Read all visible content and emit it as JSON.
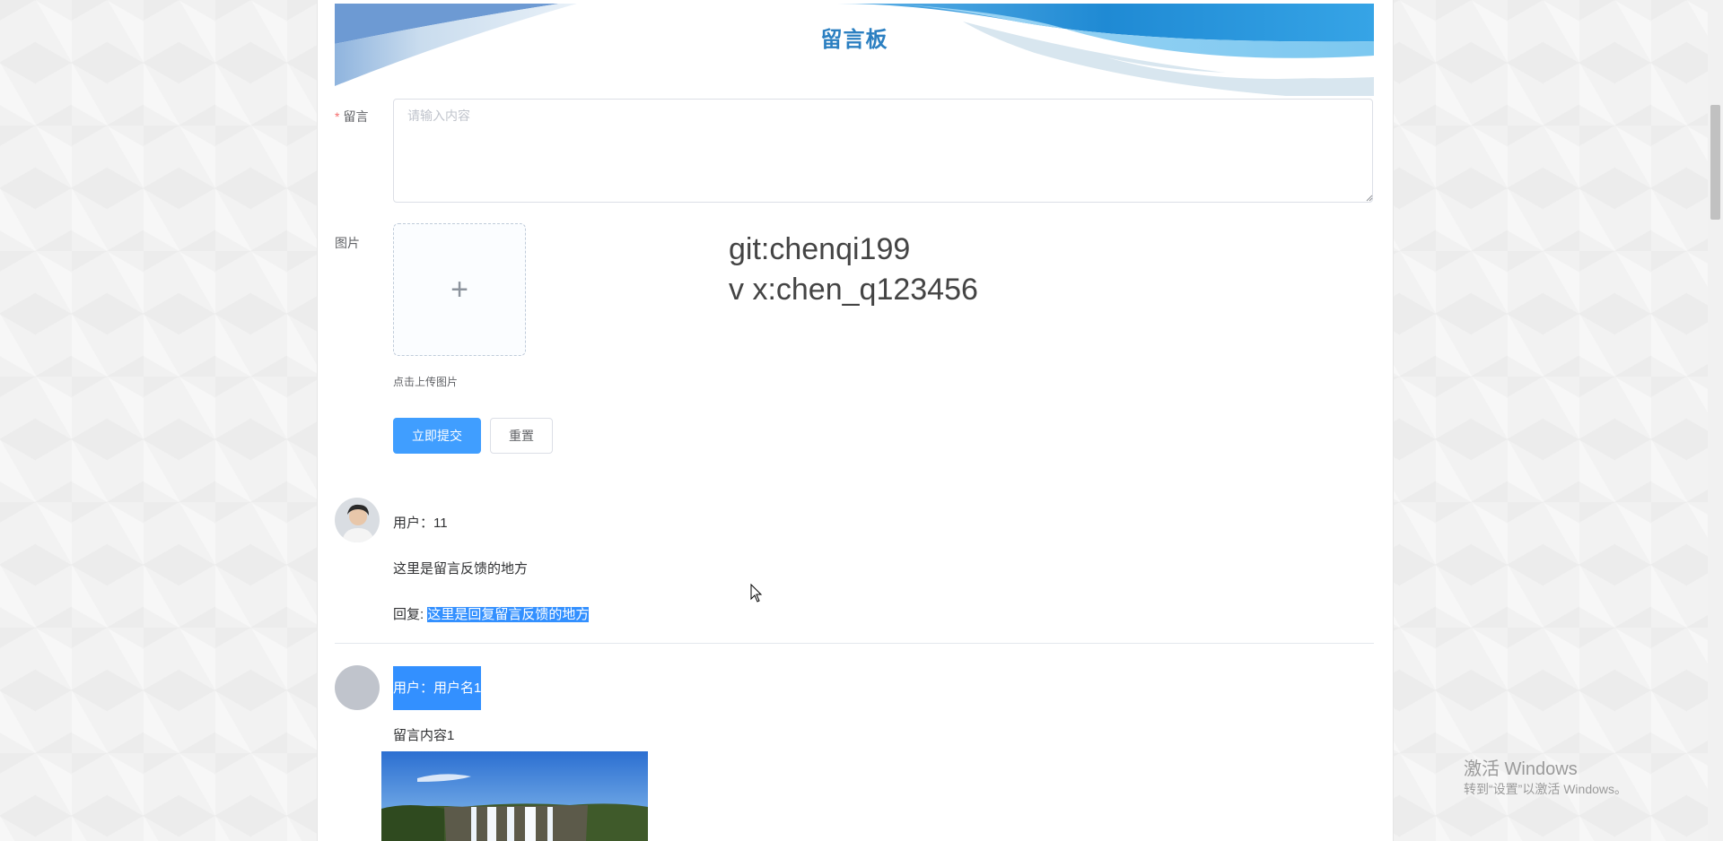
{
  "banner": {
    "title": "留言板"
  },
  "form": {
    "message_label": "留言",
    "required_mark": "*",
    "message_placeholder": "请输入内容",
    "image_label": "图片",
    "upload_plus": "+",
    "upload_tip": "点击上传图片",
    "submit_label": "立即提交",
    "reset_label": "重置"
  },
  "contact": {
    "line1": "git:chenqi199",
    "line2": "v x:chen_q123456"
  },
  "comments": [
    {
      "user": "用户：11",
      "content": "这里是留言反馈的地方",
      "reply_prefix": "回复:",
      "reply_text": "这里是回复留言反馈的地方"
    },
    {
      "user": "用户：用户名1",
      "content": "留言内容1"
    }
  ],
  "watermark": {
    "line1": "激活 Windows",
    "line2": "转到“设置”以激活 Windows。"
  },
  "colors": {
    "primary": "#409eff",
    "title": "#2b7fc1",
    "selection": "#3390ff"
  }
}
